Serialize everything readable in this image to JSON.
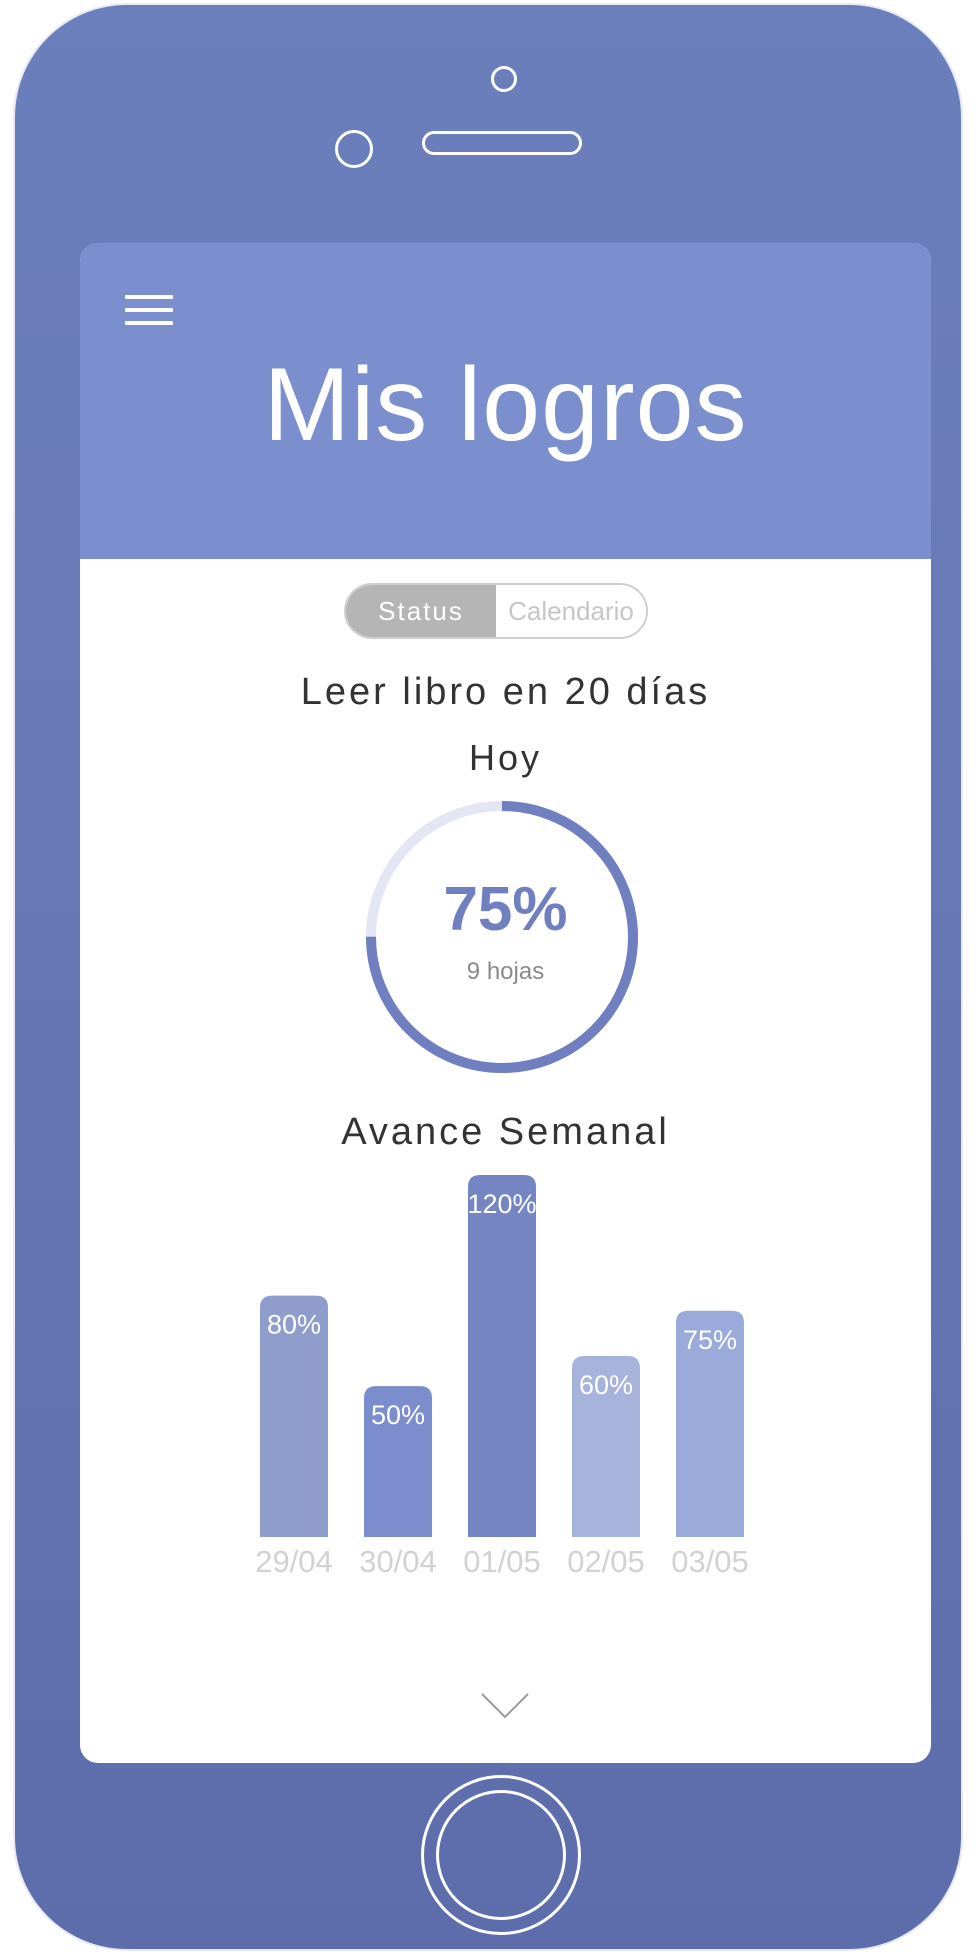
{
  "header": {
    "title": "Mis logros",
    "menu_icon": "hamburger-menu-icon"
  },
  "tabs": [
    {
      "label": "Status",
      "active": true
    },
    {
      "label": "Calendario",
      "active": false
    }
  ],
  "goal": {
    "title": "Leer libro en 20 días",
    "today_label": "Hoy",
    "progress_percent": 75,
    "progress_label": "75%",
    "pages_label": "9 hojas"
  },
  "weekly": {
    "title": "Avance Semanal"
  },
  "chart_data": {
    "type": "bar",
    "categories": [
      "29/04",
      "30/04",
      "01/05",
      "02/05",
      "03/05"
    ],
    "values": [
      80,
      50,
      120,
      60,
      75
    ],
    "data_labels": [
      "80%",
      "50%",
      "120%",
      "60%",
      "75%"
    ],
    "ylim": [
      0,
      120
    ],
    "grid": false
  },
  "colors": {
    "device": "#6676b4",
    "header": "#7b8fcf",
    "accent": "#6f7fbf",
    "ring_track": "#e4e7f3",
    "bars": [
      "#8f9dcd",
      "#7b8dcc",
      "#7584c2",
      "#a8b3dc",
      "#9aaadb"
    ],
    "tick_label": "#d2d2d2"
  },
  "footer": {
    "scroll_icon": "chevron-down-icon"
  }
}
